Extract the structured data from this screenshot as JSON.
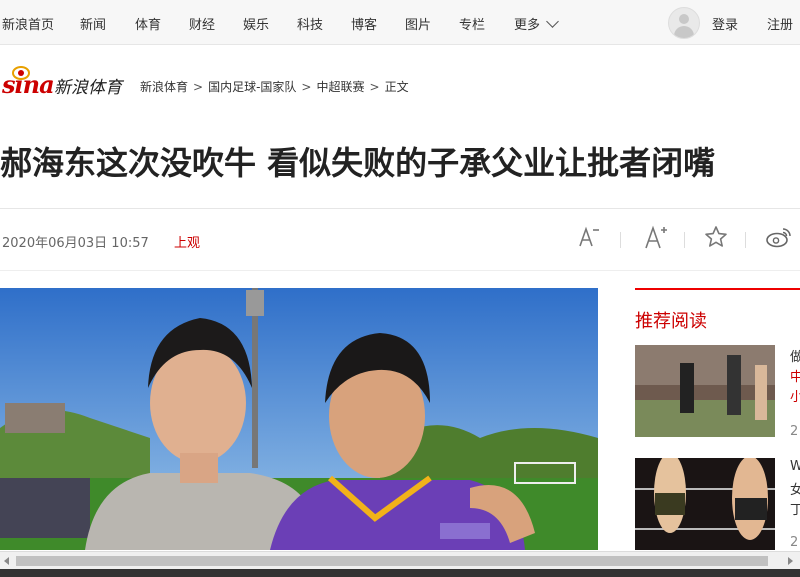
{
  "topnav": {
    "items": [
      "新浪首页",
      "新闻",
      "体育",
      "财经",
      "娱乐",
      "科技",
      "博客",
      "图片",
      "专栏",
      "更多"
    ],
    "login": "登录",
    "register": "注册"
  },
  "logo": {
    "brand": "sina",
    "site": "新浪体育"
  },
  "breadcrumb": [
    "新浪体育",
    "国内足球-国家队",
    "中超联赛",
    "正文"
  ],
  "breadcrumb_separator": ">",
  "article": {
    "headline": "郝海东这次没吹牛 看似失败的子承父业让批者闭嘴",
    "date": "2020年06月03日 10:57",
    "source": "上观"
  },
  "toolbar": {
    "font_small_icon": "font-decrease-icon",
    "font_large_icon": "font-increase-icon",
    "favorite_icon": "star-icon",
    "weibo_icon": "weibo-share-icon"
  },
  "sidebar": {
    "title": "推荐阅读",
    "items": [
      {
        "lines": [
          "做",
          "中",
          "小"
        ],
        "suffix": "2"
      },
      {
        "lines": [
          "W",
          "女",
          "丁"
        ],
        "suffix": "2"
      }
    ]
  },
  "colors": {
    "accent": "#cc0000",
    "link": "#333333"
  }
}
